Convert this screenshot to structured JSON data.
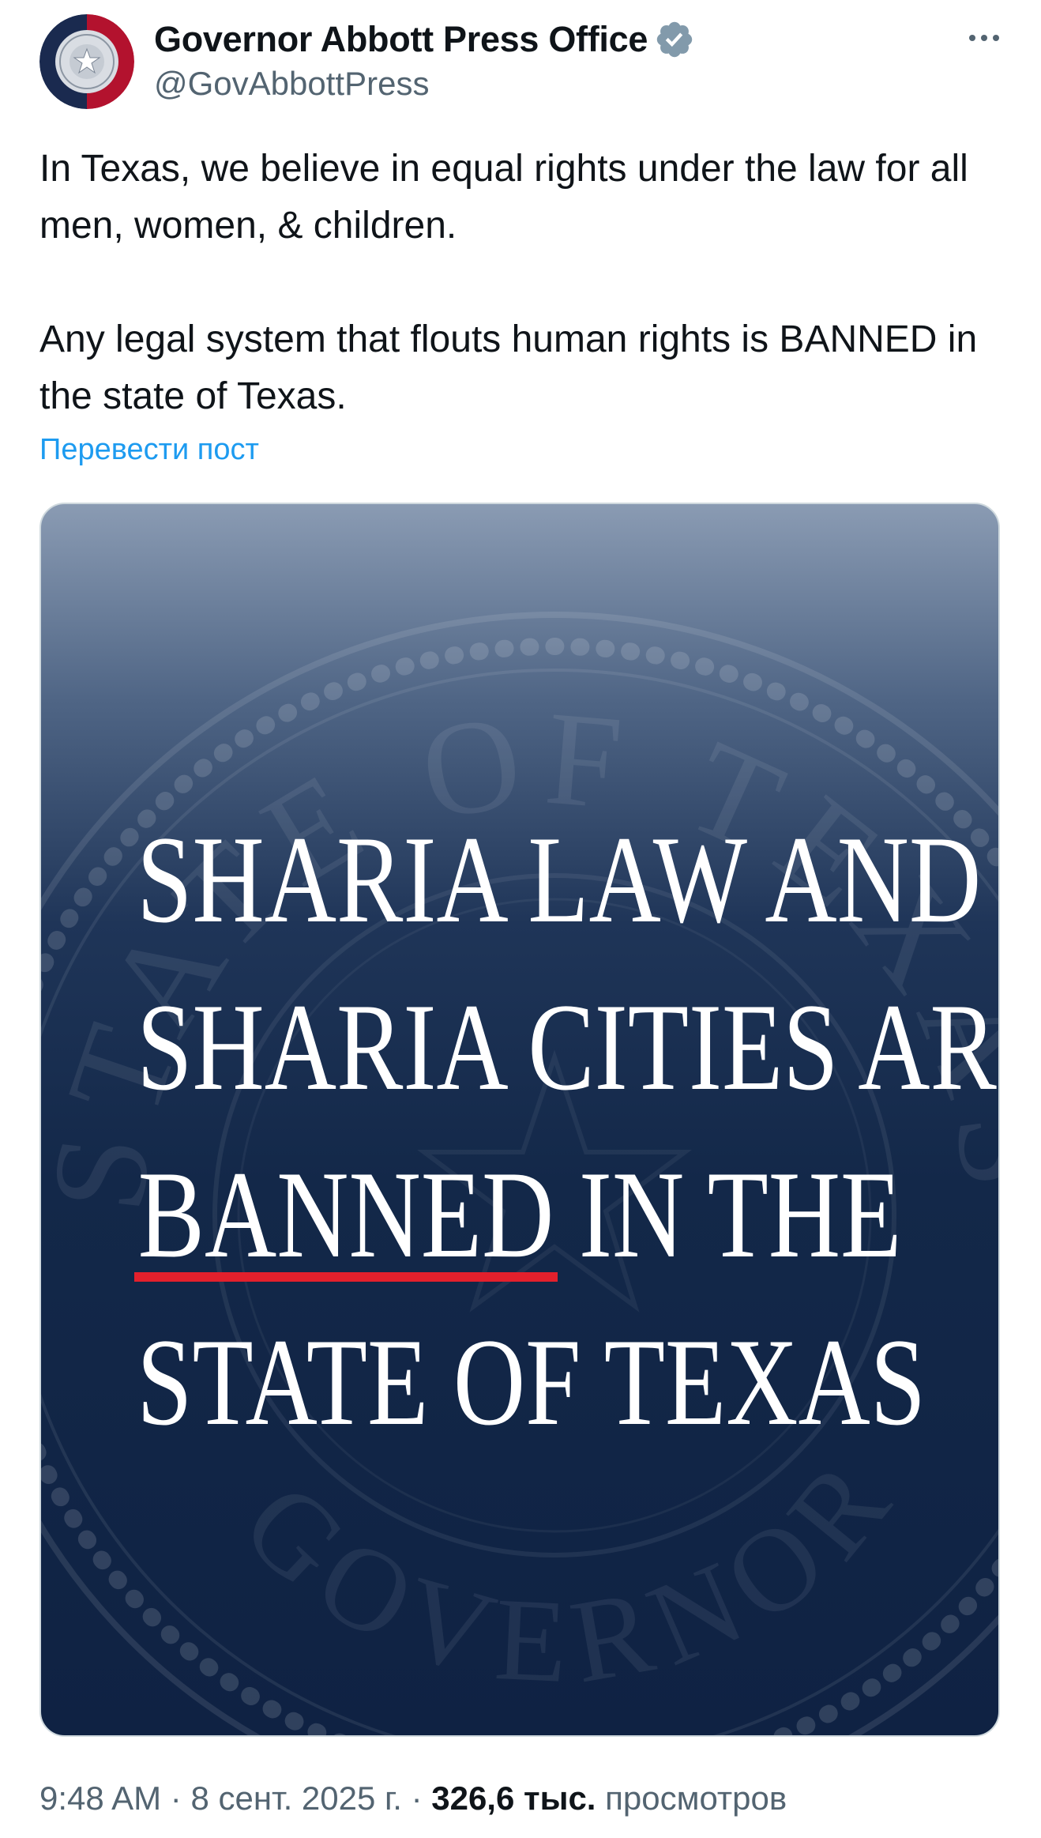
{
  "account": {
    "display_name": "Governor Abbott Press Office",
    "handle": "@GovAbbottPress",
    "verified_icon": "verified-badge-icon",
    "avatar_colors": {
      "left": "#1a2a4f",
      "right": "#b3122e"
    }
  },
  "tweet": {
    "paragraph_1": "In Texas, we believe in equal rights under the law for all men, women, & children.",
    "paragraph_2": "Any legal system that flouts human rights is BANNED in the state of Texas.",
    "translate_label": "Перевести пост"
  },
  "media": {
    "line1": "SHARIA LAW AND",
    "line2": "SHARIA CITIES ARE",
    "line3_emphasis": "BANNED",
    "line3_rest": " IN THE",
    "line4": "STATE OF TEXAS",
    "seal_top_text": "STATE OF TEXAS",
    "seal_bottom_text": "GOVERNOR",
    "underline_color": "#e3202c"
  },
  "meta": {
    "time": "9:48 AM",
    "separator": " · ",
    "date": "8 сент. 2025 г.",
    "views_count": "326,6 тыс.",
    "views_label": " просмотров"
  }
}
